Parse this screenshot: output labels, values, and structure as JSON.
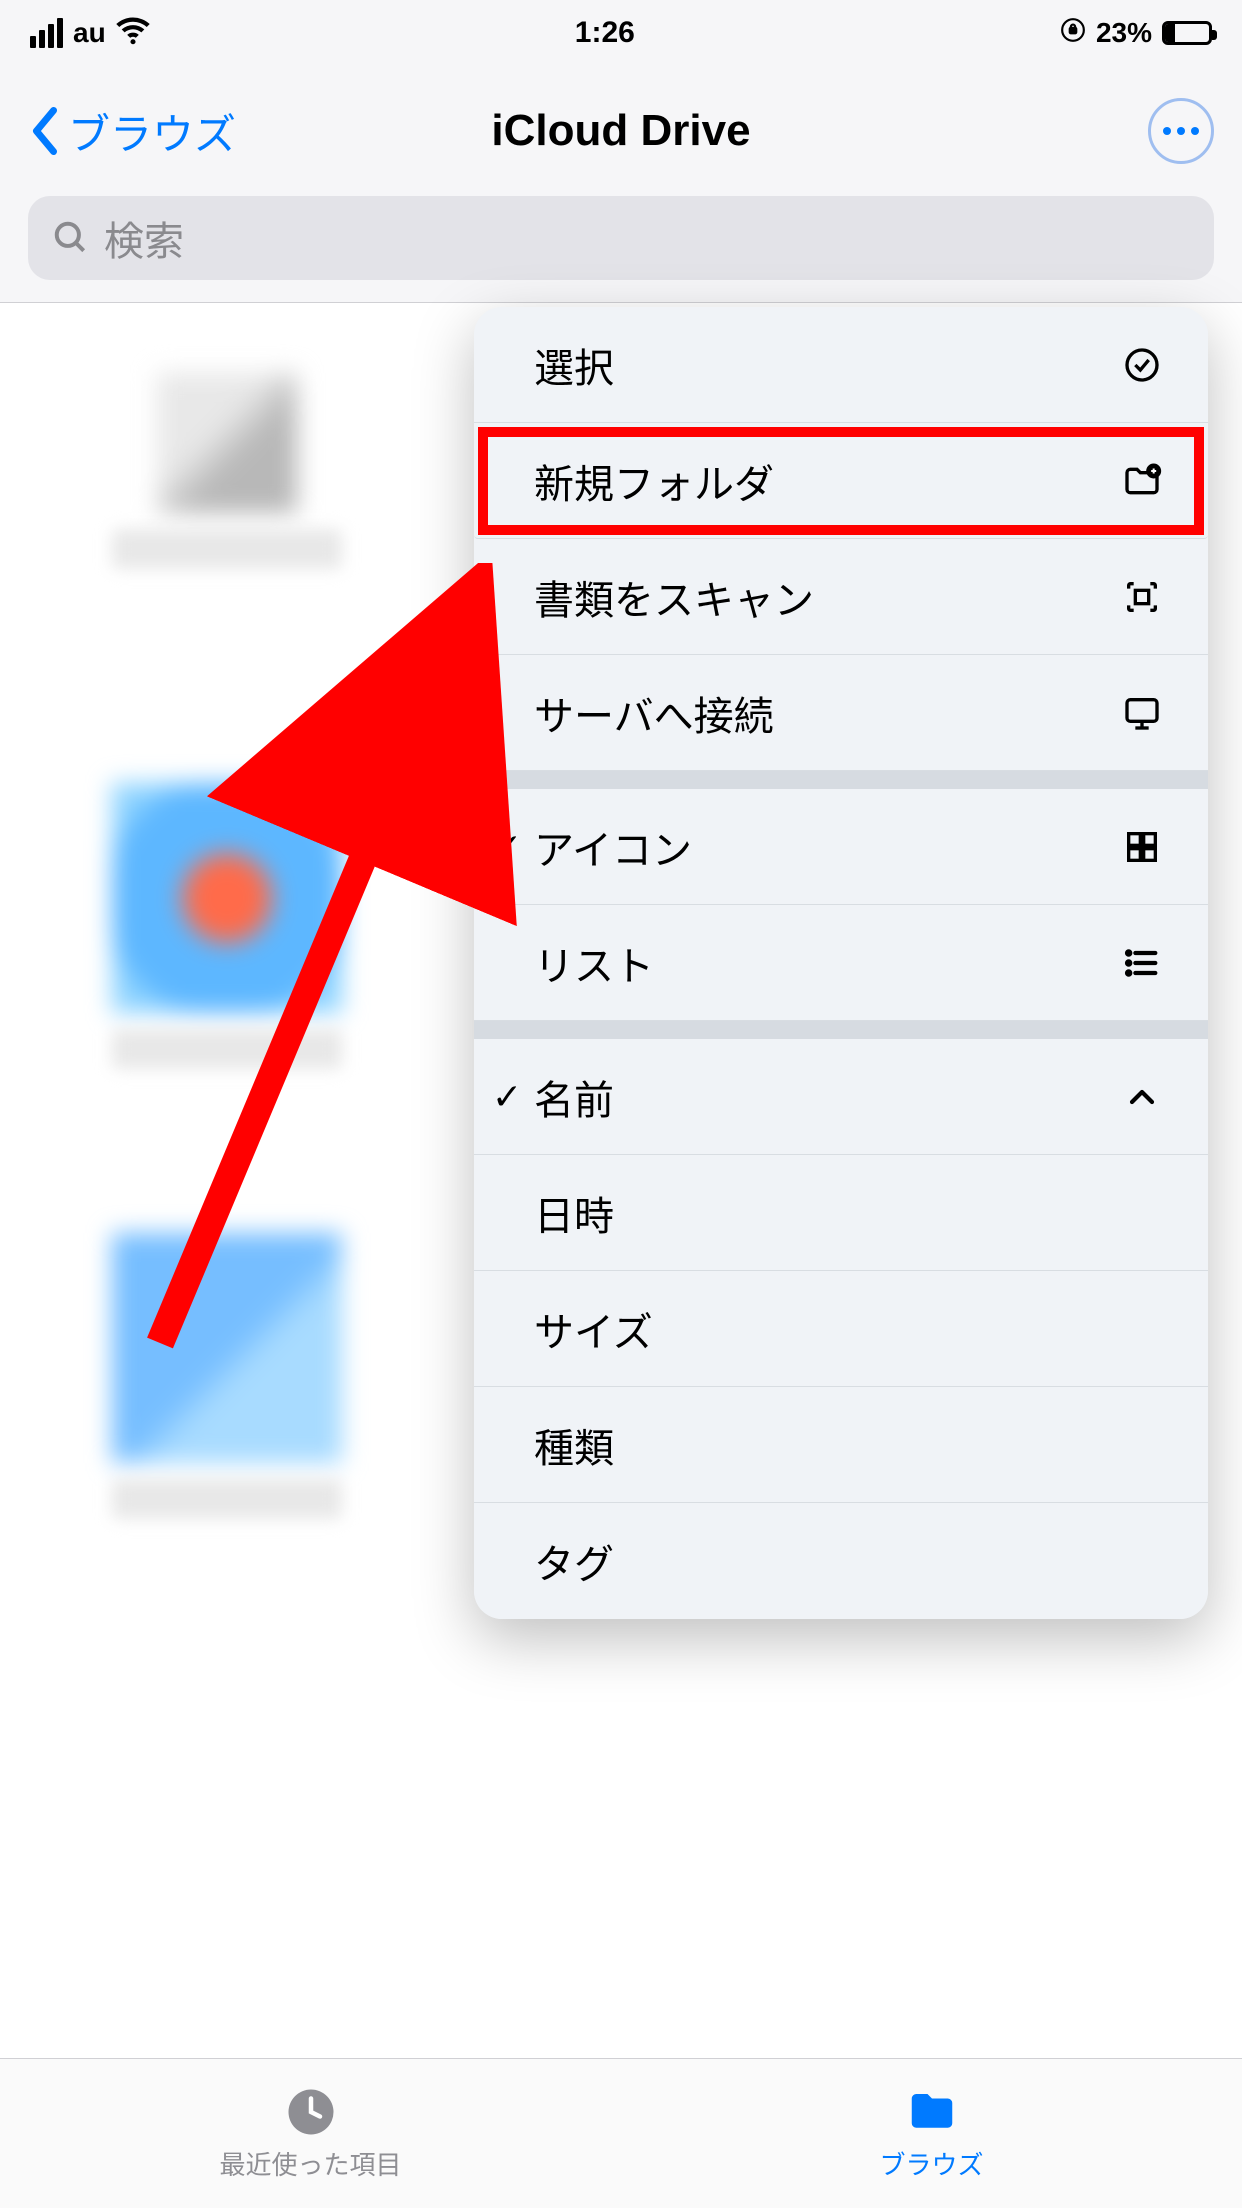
{
  "status": {
    "carrier": "au",
    "time": "1:26",
    "battery_pct": "23%"
  },
  "nav": {
    "back_label": "ブラウズ",
    "title": "iCloud Drive"
  },
  "search": {
    "placeholder": "検索"
  },
  "menu": {
    "groups": [
      [
        {
          "label": "選択",
          "icon": "checkmark-circle",
          "highlight": false
        },
        {
          "label": "新規フォルダ",
          "icon": "folder-plus",
          "highlight": true
        },
        {
          "label": "書類をスキャン",
          "icon": "scan",
          "highlight": false
        },
        {
          "label": "サーバへ接続",
          "icon": "display",
          "highlight": false
        }
      ],
      [
        {
          "label": "アイコン",
          "icon": "grid",
          "checked": true
        },
        {
          "label": "リスト",
          "icon": "list",
          "checked": false
        }
      ],
      [
        {
          "label": "名前",
          "icon": "chevron-up",
          "checked": true
        },
        {
          "label": "日時",
          "icon": "",
          "checked": false
        },
        {
          "label": "サイズ",
          "icon": "",
          "checked": false
        },
        {
          "label": "種類",
          "icon": "",
          "checked": false
        },
        {
          "label": "タグ",
          "icon": "",
          "checked": false
        }
      ]
    ]
  },
  "tabs": {
    "recent": "最近使った項目",
    "browse": "ブラウズ"
  }
}
